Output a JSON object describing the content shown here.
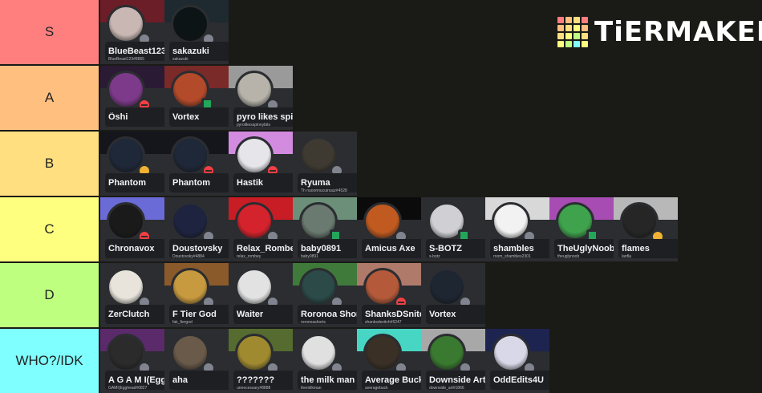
{
  "logo": {
    "text": "TiERMAKER",
    "grid_colors": [
      "#ff7f7f",
      "#ffbf7f",
      "#ffdf7f",
      "#ff7f7f",
      "#ffbf7f",
      "#ffdf7f",
      "#ffff7f",
      "#ffbf7f",
      "#ffdf7f",
      "#ffff7f",
      "#bfff7f",
      "#ffdf7f",
      "#ffff7f",
      "#bfff7f",
      "#7fffff",
      "#ffff7f"
    ]
  },
  "tiers": [
    {
      "label": "S",
      "color": "#ff7f7f",
      "items": [
        {
          "name": "BlueBeast123",
          "tag": "BlueBeast123#8865",
          "banner": "#6b1d28",
          "avatar": "#c9b7b3",
          "status": "none"
        },
        {
          "name": "sakazuki",
          "tag": "sakazuki",
          "banner": "#1e2a30",
          "avatar": "#0d1416",
          "status": "online"
        }
      ]
    },
    {
      "label": "A",
      "color": "#ffbf7f",
      "items": [
        {
          "name": "Öshi",
          "tag": "",
          "banner": "#2a1a34",
          "avatar": "#7d3a8a",
          "status": "dnd"
        },
        {
          "name": "Vortex",
          "tag": "",
          "banner": "#7a2a28",
          "avatar": "#b34a2a",
          "status": "mobile"
        },
        {
          "name": "pyro likes spinny b",
          "tag": "pyrolikesspinnybits",
          "banner": "#9a9a9a",
          "avatar": "#b7b3aa",
          "status": "none"
        }
      ]
    },
    {
      "label": "B",
      "color": "#ffdf7f",
      "items": [
        {
          "name": "Phantom",
          "tag": "",
          "banner": "#14161c",
          "avatar": "#1f2838",
          "status": "idle"
        },
        {
          "name": "Phantom",
          "tag": "",
          "banner": "#14161c",
          "avatar": "#1f2838",
          "status": "dnd"
        },
        {
          "name": "Hastik",
          "tag": "",
          "banner": "#d38be0",
          "avatar": "#e6e6ea",
          "status": "dnd"
        },
        {
          "name": "Ryuma",
          "tag": "Th nuoonnucuinuuz#4528",
          "banner": "#2b2d31",
          "avatar": "#3e3a32",
          "status": "none"
        }
      ]
    },
    {
      "label": "C",
      "color": "#ffff7f",
      "items": [
        {
          "name": "Chronavox",
          "tag": "",
          "banner": "#6b6bd8",
          "avatar": "#1a1a1a",
          "status": "dnd"
        },
        {
          "name": "Doustovsky",
          "tag": "Doustovsky#4884",
          "banner": "#2b2d31",
          "avatar": "#1e2440",
          "status": "none"
        },
        {
          "name": "Relax_Rombey",
          "tag": "relax_rombey",
          "banner": "#c81d25",
          "avatar": "#d4232c",
          "status": "none"
        },
        {
          "name": "baby0891",
          "tag": "baby0891",
          "banner": "#6c8f7a",
          "avatar": "#6a7a70",
          "status": "mobile"
        },
        {
          "name": "Amicus Axe",
          "tag": "",
          "banner": "#0b0b0b",
          "avatar": "#c05a20",
          "status": "none"
        },
        {
          "name": "S-BOTZ",
          "tag": "s-botz",
          "banner": "#2b2d31",
          "avatar": "#d0d0d4",
          "status": "mobile"
        },
        {
          "name": "shambles",
          "tag": "room_shambles2301",
          "banner": "#d8d8d8",
          "avatar": "#f2f2f2",
          "status": "none"
        },
        {
          "name": "TheUglyNoob",
          "tag": "theuglynoob",
          "banner": "#a64cb3",
          "avatar": "#3fa34d",
          "status": "mobile"
        },
        {
          "name": "flames",
          "tag": "lanfla",
          "banner": "#b8b8b8",
          "avatar": "#262626",
          "status": "idle"
        }
      ]
    },
    {
      "label": "D",
      "color": "#bfff7f",
      "items": [
        {
          "name": "ZerClutch",
          "tag": "",
          "banner": "#2b2d31",
          "avatar": "#e8e4dc",
          "status": "none"
        },
        {
          "name": "F Tier God",
          "tag": "fak_fiergod",
          "banner": "#8b5a2b",
          "avatar": "#c79a3f",
          "status": "none"
        },
        {
          "name": "Waiter",
          "tag": "",
          "banner": "#2b2d31",
          "avatar": "#e2e2e2",
          "status": "none"
        },
        {
          "name": "Roronoa Shorts",
          "tag": "roronoashorts",
          "banner": "#3f7a3a",
          "avatar": "#2b4a48",
          "status": "none"
        },
        {
          "name": "ShanksDSnitch",
          "tag": "shanksdsnitch#5247",
          "banner": "#b07a6a",
          "avatar": "#b45a3a",
          "status": "dnd"
        },
        {
          "name": "Vortex",
          "tag": "",
          "banner": "#2b2d31",
          "avatar": "#1e2632",
          "status": "none"
        }
      ]
    },
    {
      "label": "WHO?/IDK",
      "color": "#7fffff",
      "items": [
        {
          "name": "A G A M I(Egghe",
          "tag": "GAMI(Egghead#0827",
          "banner": "#5a2a6a",
          "avatar": "#2b2b2b",
          "status": "none"
        },
        {
          "name": "aha",
          "tag": "",
          "banner": "#2b2d31",
          "avatar": "#6a5a4a",
          "status": "none"
        },
        {
          "name": "???????",
          "tag": "unnecessary#8888",
          "banner": "#556b2f",
          "avatar": "#a08a30",
          "status": "none"
        },
        {
          "name": "the milk man",
          "tag": "themilkman",
          "banner": "#2b2d31",
          "avatar": "#e0e0e0",
          "status": "none"
        },
        {
          "name": "Average Buck",
          "tag": "averagebuck",
          "banner": "#48d6c4",
          "avatar": "#3a3026",
          "status": "none"
        },
        {
          "name": "Downside Art",
          "tag": "downside_art#1866",
          "banner": "#a8a8a8",
          "avatar": "#3a7a30",
          "status": "none"
        },
        {
          "name": "OddEdits4U",
          "tag": "",
          "banner": "#1e2450",
          "avatar": "#d8d8e8",
          "status": "none"
        }
      ]
    }
  ]
}
